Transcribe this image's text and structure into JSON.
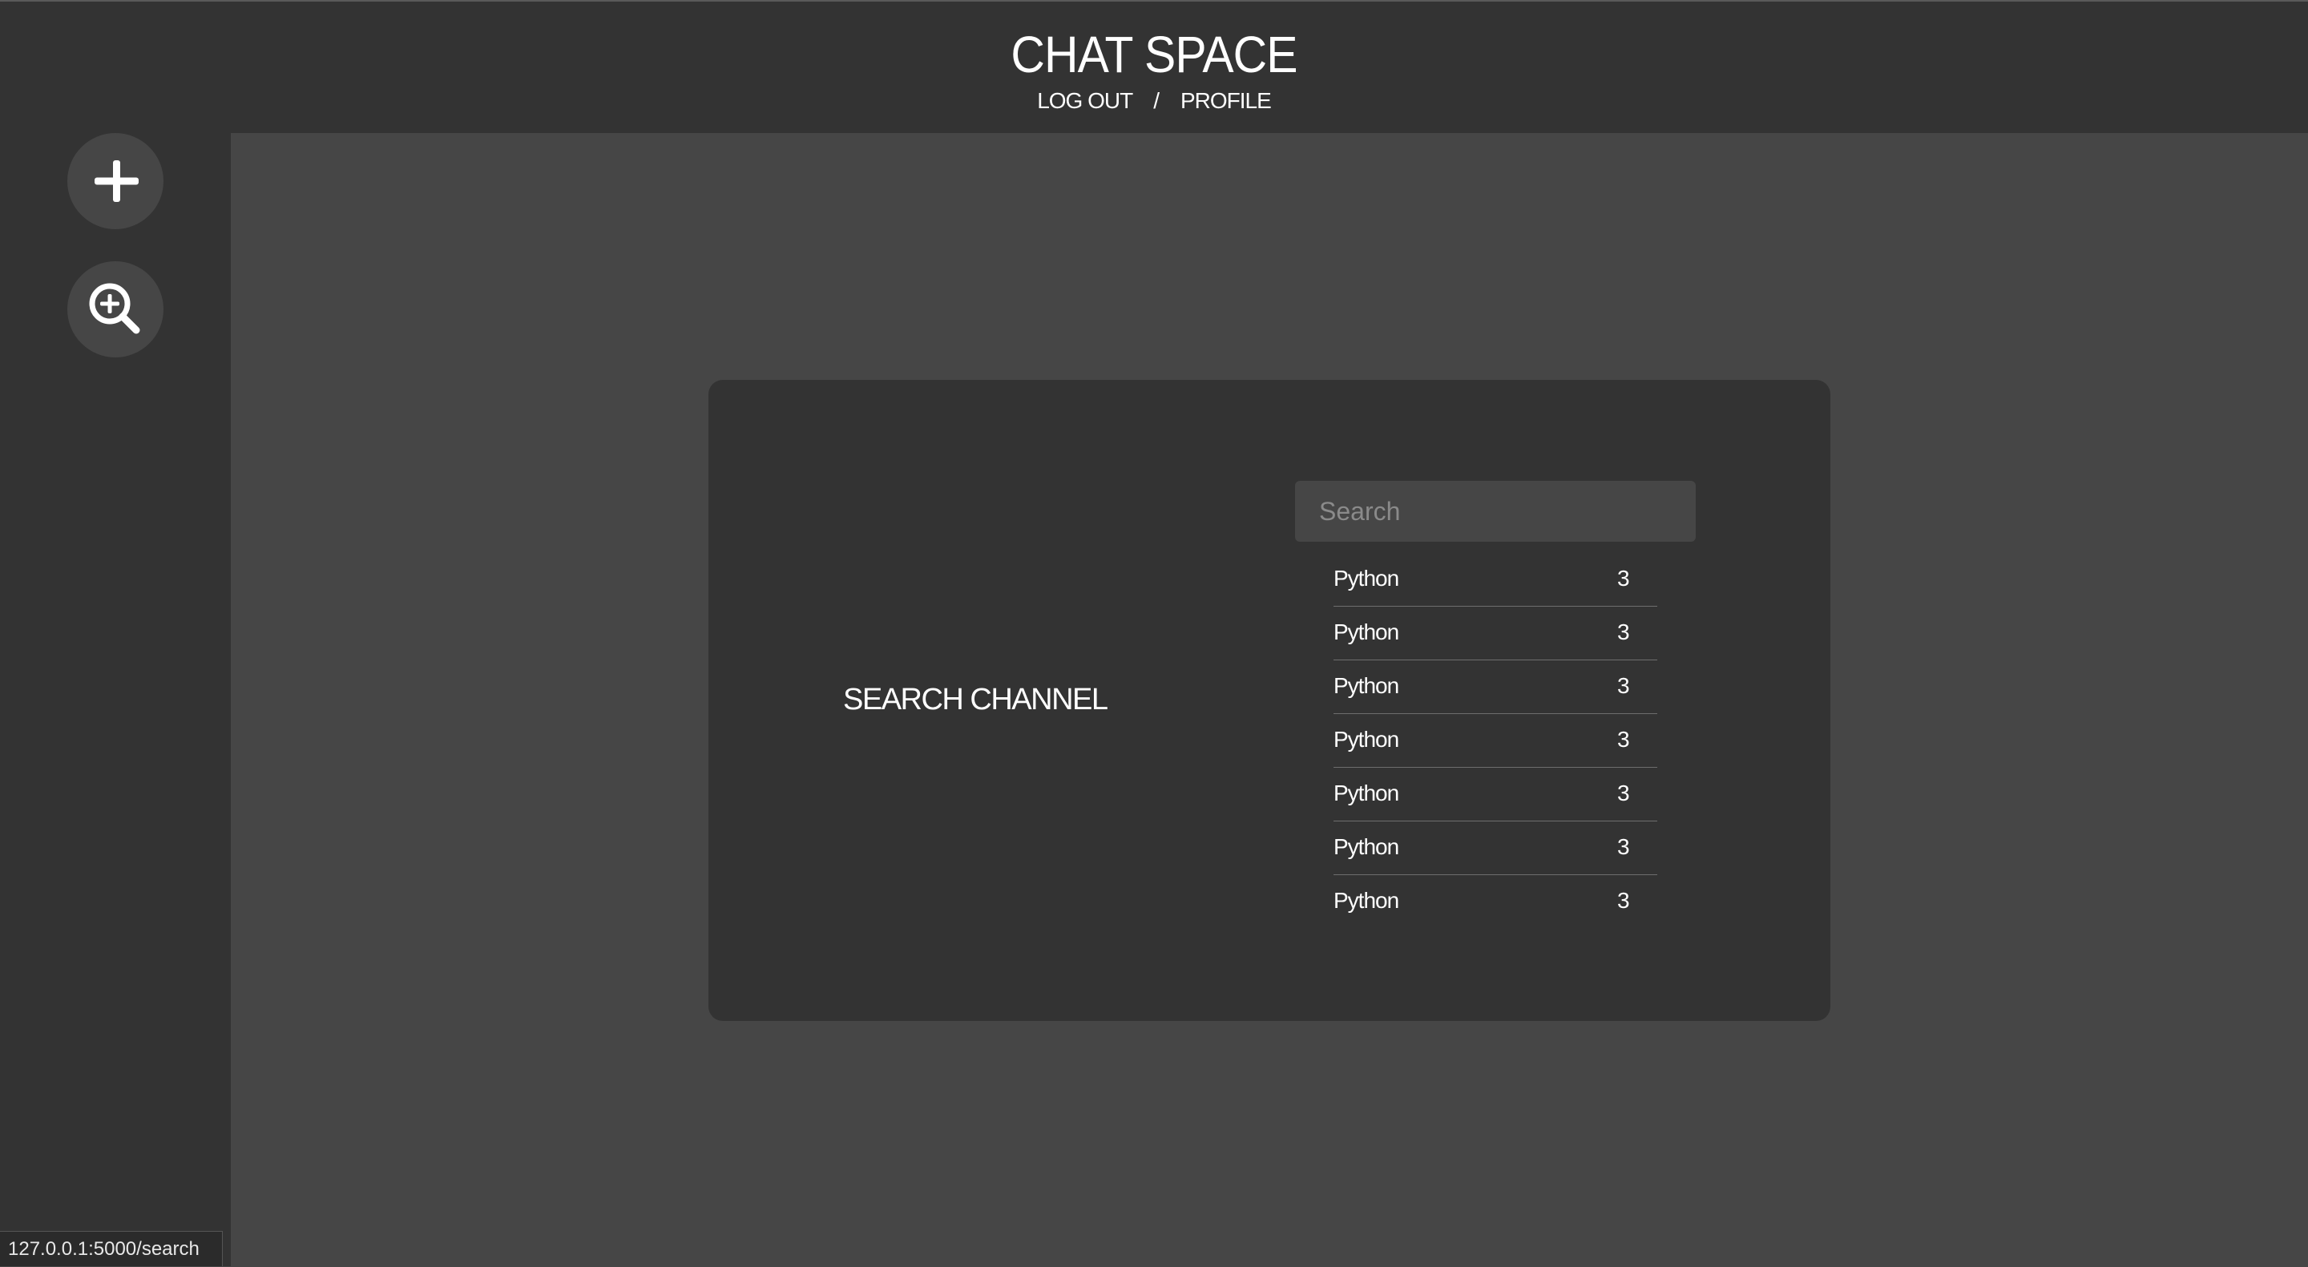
{
  "header": {
    "title": "CHAT SPACE",
    "nav": {
      "logout_label": "LOG OUT",
      "separator": "/",
      "profile_label": "PROFILE"
    }
  },
  "sidebar": {
    "buttons": [
      {
        "icon": "plus-icon"
      },
      {
        "icon": "search-plus-icon"
      }
    ]
  },
  "search_card": {
    "title": "SEARCH CHANNEL",
    "search": {
      "placeholder": "Search",
      "value": ""
    },
    "channels": [
      {
        "name": "Python",
        "count": "3"
      },
      {
        "name": "Python",
        "count": "3"
      },
      {
        "name": "Python",
        "count": "3"
      },
      {
        "name": "Python",
        "count": "3"
      },
      {
        "name": "Python",
        "count": "3"
      },
      {
        "name": "Python",
        "count": "3"
      },
      {
        "name": "Python",
        "count": "3"
      }
    ]
  },
  "status_bar": {
    "url": "127.0.0.1:5000/search"
  },
  "colors": {
    "header_bg": "#333333",
    "page_bg": "#464646",
    "card_bg": "#333333",
    "text": "#ffffff"
  }
}
